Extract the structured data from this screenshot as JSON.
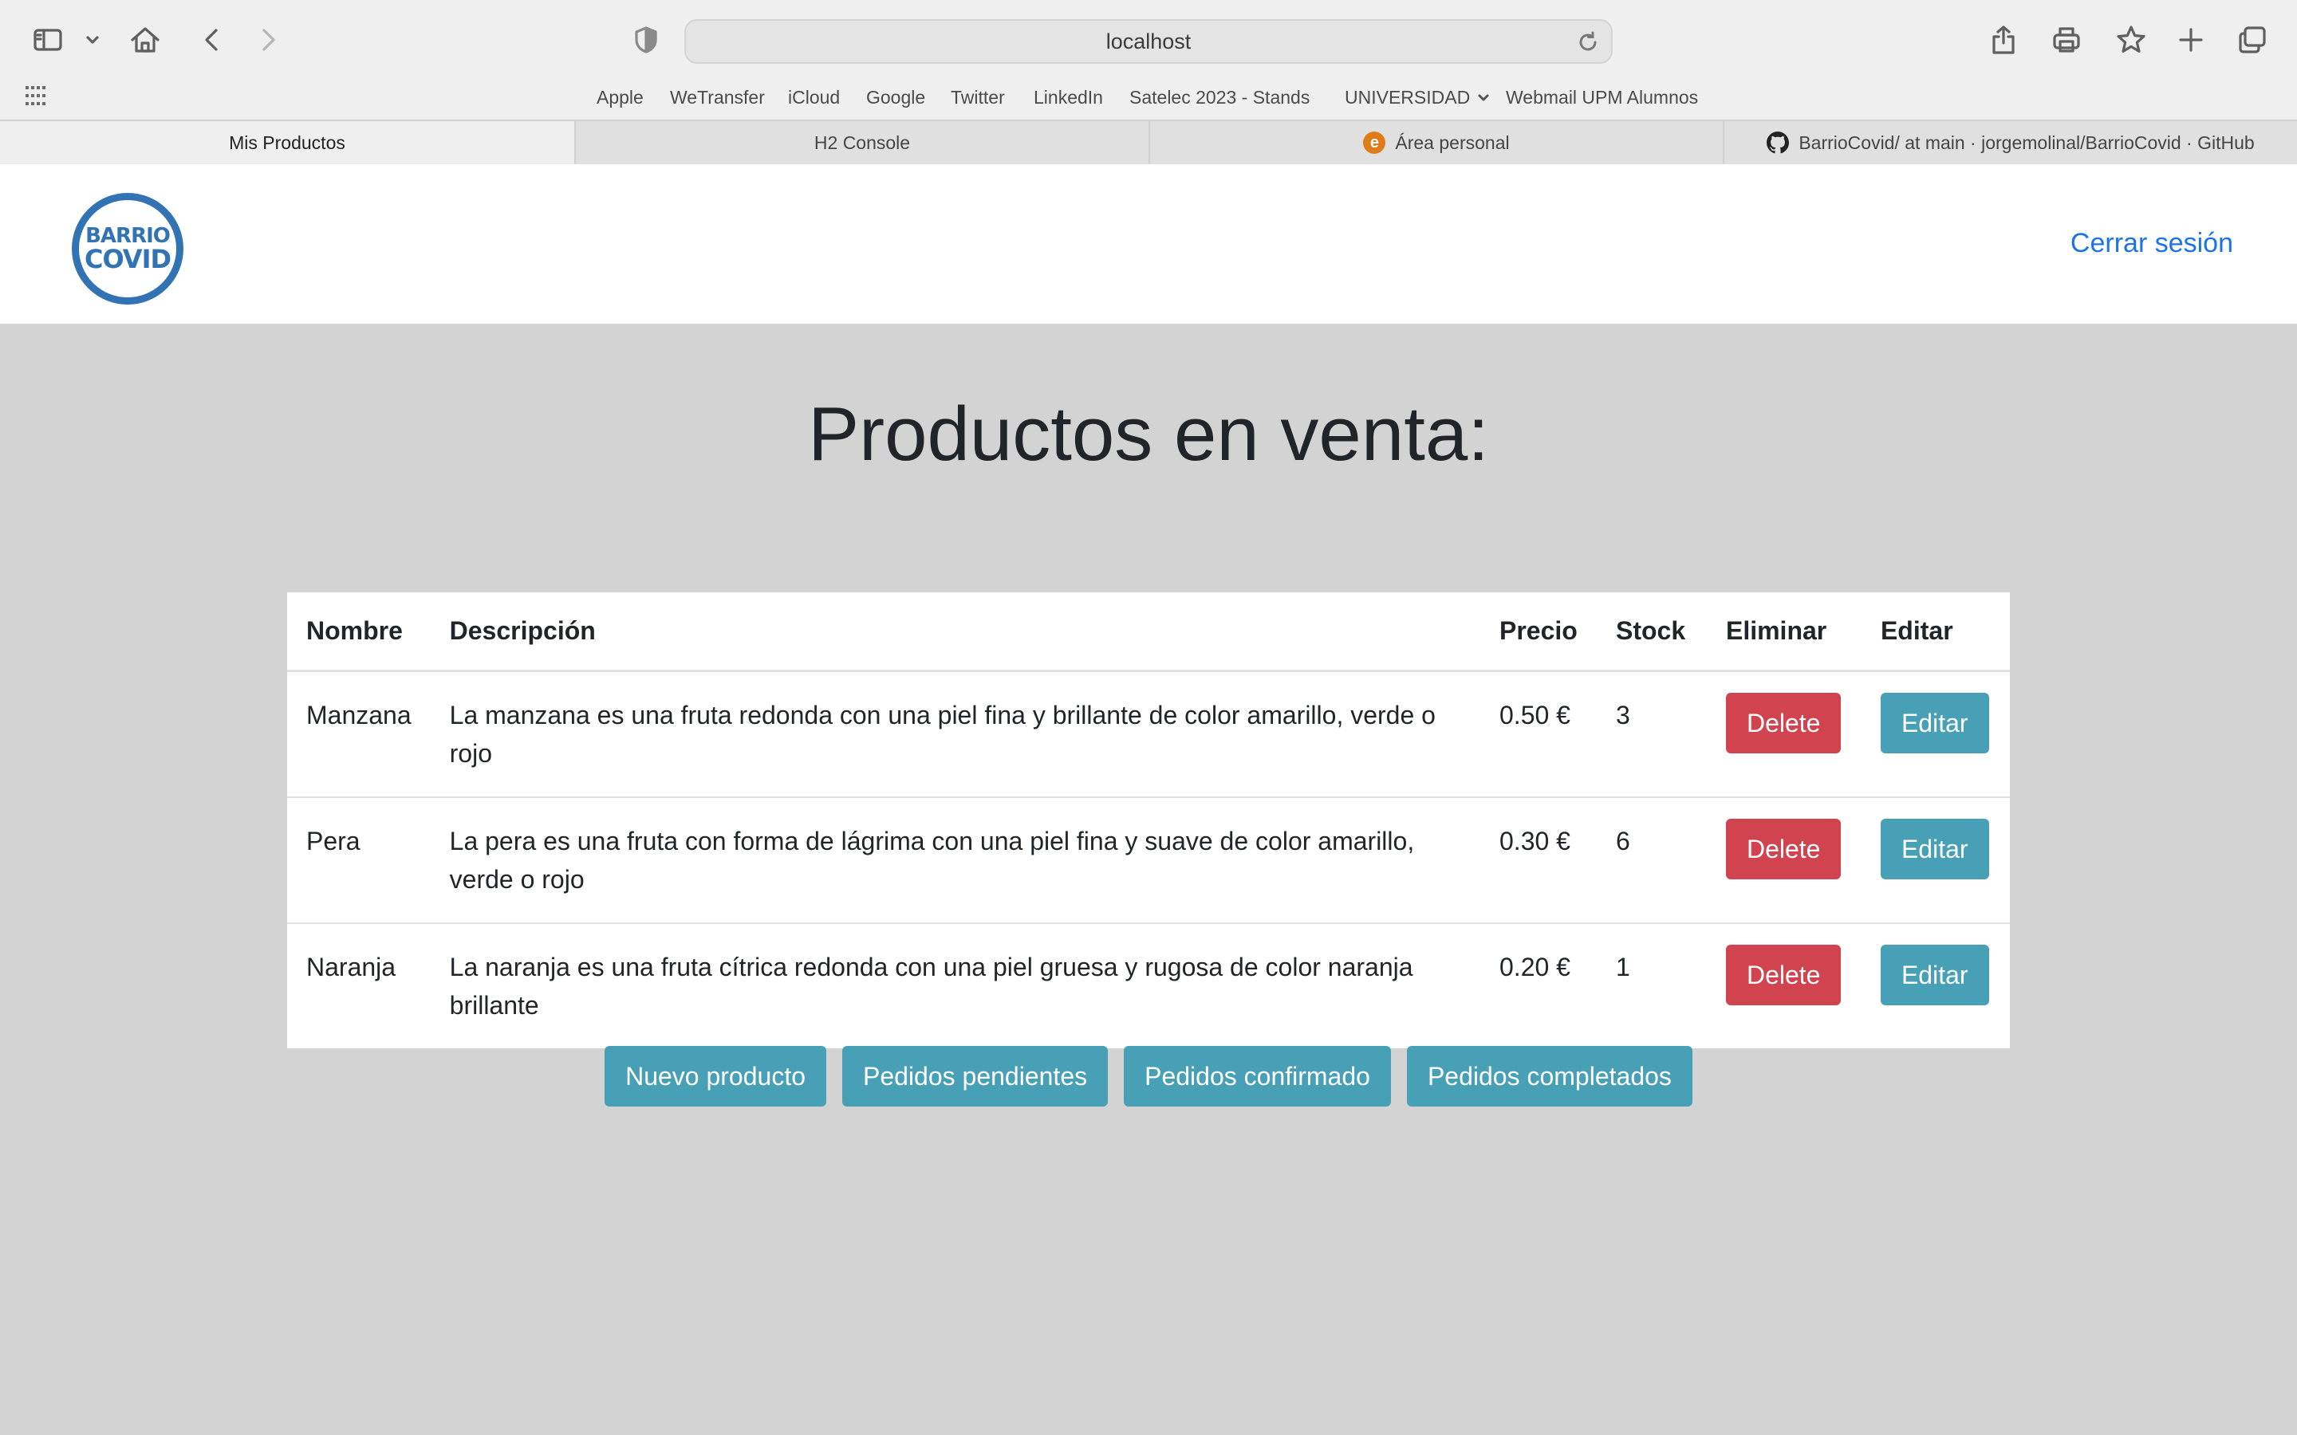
{
  "browser": {
    "url": "localhost",
    "bookmarks": [
      {
        "label": "Apple"
      },
      {
        "label": "WeTransfer"
      },
      {
        "label": "iCloud"
      },
      {
        "label": "Google"
      },
      {
        "label": "Twitter"
      },
      {
        "label": "LinkedIn"
      },
      {
        "label": "Satelec 2023 - Stands"
      },
      {
        "label": "UNIVERSIDAD"
      },
      {
        "label": "Webmail UPM Alumnos"
      }
    ],
    "tabs": [
      {
        "label": "Mis Productos",
        "active": true
      },
      {
        "label": "H2 Console",
        "active": false
      },
      {
        "label": "Área personal",
        "active": false,
        "favicon": "e"
      },
      {
        "label": "BarrioCovid/ at main · jorgemolinal/BarrioCovid · GitHub",
        "active": false
      }
    ]
  },
  "header": {
    "logo": {
      "line1": "BARRIO",
      "line2": "COVID"
    },
    "logout_label": "Cerrar sesión"
  },
  "main": {
    "title": "Productos en venta:",
    "table": {
      "columns": [
        "Nombre",
        "Descripción",
        "Precio",
        "Stock",
        "Eliminar",
        "Editar"
      ],
      "rows": [
        {
          "nombre": "Manzana",
          "descripcion": "La manzana es una fruta redonda con una piel fina y brillante de color amarillo, verde o rojo",
          "precio": "0.50 €",
          "stock": "3",
          "delete_label": "Delete",
          "edit_label": "Editar"
        },
        {
          "nombre": "Pera",
          "descripcion": "La pera es una fruta con forma de lágrima con una piel fina y suave de color amarillo, verde o rojo",
          "precio": "0.30 €",
          "stock": "6",
          "delete_label": "Delete",
          "edit_label": "Editar"
        },
        {
          "nombre": "Naranja",
          "descripcion": "La naranja es una fruta cítrica redonda con una piel gruesa y rugosa de color naranja brillante",
          "precio": "0.20 €",
          "stock": "1",
          "delete_label": "Delete",
          "edit_label": "Editar"
        }
      ]
    },
    "actions": {
      "new_product": "Nuevo producto",
      "pending_orders": "Pedidos pendientes",
      "confirmed_orders": "Pedidos confirmado",
      "completed_orders": "Pedidos completados"
    }
  },
  "colors": {
    "page_bg": "#d3d3d3",
    "danger": "#d1434f",
    "info": "#48a0b7",
    "link": "#1a73e8",
    "logo": "#3273b4"
  }
}
